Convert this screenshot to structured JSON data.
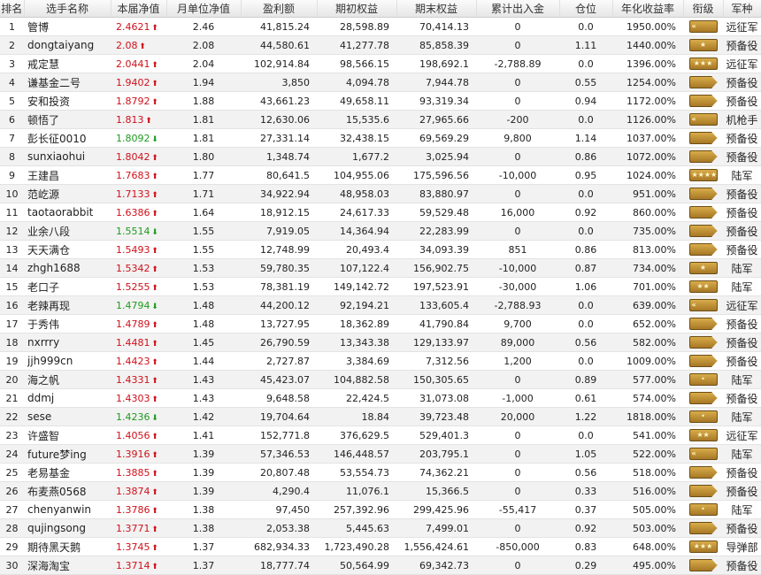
{
  "headers": [
    "排名",
    "选手名称",
    "本届净值",
    "月单位净值",
    "盈利额",
    "期初权益",
    "期末权益",
    "累计出入金",
    "仓位",
    "年化收益率",
    "衔级",
    "军种"
  ],
  "colors": {
    "up": "#d0101a",
    "down": "#1e9a1e"
  },
  "rows": [
    {
      "rank": "1",
      "name": "管博",
      "nav": "2.4621",
      "dir": "up",
      "unit": "2.46",
      "profit": "41,815.24",
      "start": "28,598.89",
      "end": "70,414.13",
      "flow": "0",
      "pos": "0.0",
      "annual": "1950.00%",
      "badge": "chevron",
      "army": "远征军"
    },
    {
      "rank": "2",
      "name": "dongtaiyang",
      "nav": "2.08",
      "dir": "up",
      "unit": "2.08",
      "profit": "44,580.61",
      "start": "41,277.78",
      "end": "85,858.39",
      "flow": "0",
      "pos": "1.11",
      "annual": "1440.00%",
      "badge": "star1",
      "army": "预备役"
    },
    {
      "rank": "3",
      "name": "戒定慧",
      "nav": "2.0441",
      "dir": "up",
      "unit": "2.04",
      "profit": "102,914.84",
      "start": "98,566.15",
      "end": "198,692.1",
      "flow": "-2,788.89",
      "pos": "0.0",
      "annual": "1396.00%",
      "badge": "star3",
      "army": "远征军"
    },
    {
      "rank": "4",
      "name": "谦基金二号",
      "nav": "1.9402",
      "dir": "up",
      "unit": "1.94",
      "profit": "3,850",
      "start": "4,094.78",
      "end": "7,944.78",
      "flow": "0",
      "pos": "0.55",
      "annual": "1254.00%",
      "badge": "pointed",
      "army": "预备役"
    },
    {
      "rank": "5",
      "name": "安和投资",
      "nav": "1.8792",
      "dir": "up",
      "unit": "1.88",
      "profit": "43,661.23",
      "start": "49,658.11",
      "end": "93,319.34",
      "flow": "0",
      "pos": "0.94",
      "annual": "1172.00%",
      "badge": "pointed",
      "army": "预备役"
    },
    {
      "rank": "6",
      "name": "顿悟了",
      "nav": "1.813",
      "dir": "up",
      "unit": "1.81",
      "profit": "12,630.06",
      "start": "15,535.6",
      "end": "27,965.66",
      "flow": "-200",
      "pos": "0.0",
      "annual": "1126.00%",
      "badge": "chevron",
      "army": "机枪手"
    },
    {
      "rank": "7",
      "name": "彭长征0010",
      "nav": "1.8092",
      "dir": "down",
      "unit": "1.81",
      "profit": "27,331.14",
      "start": "32,438.15",
      "end": "69,569.29",
      "flow": "9,800",
      "pos": "1.14",
      "annual": "1037.00%",
      "badge": "pointed",
      "army": "预备役"
    },
    {
      "rank": "8",
      "name": "sunxiaohui",
      "nav": "1.8042",
      "dir": "up",
      "unit": "1.80",
      "profit": "1,348.74",
      "start": "1,677.2",
      "end": "3,025.94",
      "flow": "0",
      "pos": "0.86",
      "annual": "1072.00%",
      "badge": "pointed",
      "army": "预备役"
    },
    {
      "rank": "9",
      "name": "王建昌",
      "nav": "1.7683",
      "dir": "up",
      "unit": "1.77",
      "profit": "80,641.5",
      "start": "104,955.06",
      "end": "175,596.56",
      "flow": "-10,000",
      "pos": "0.95",
      "annual": "1024.00%",
      "badge": "star4",
      "army": "陆军"
    },
    {
      "rank": "10",
      "name": "范屹源",
      "nav": "1.7133",
      "dir": "up",
      "unit": "1.71",
      "profit": "34,922.94",
      "start": "48,958.03",
      "end": "83,880.97",
      "flow": "0",
      "pos": "0.0",
      "annual": "951.00%",
      "badge": "pointed",
      "army": "预备役"
    },
    {
      "rank": "11",
      "name": "taotaorabbit",
      "nav": "1.6386",
      "dir": "up",
      "unit": "1.64",
      "profit": "18,912.15",
      "start": "24,617.33",
      "end": "59,529.48",
      "flow": "16,000",
      "pos": "0.92",
      "annual": "860.00%",
      "badge": "pointed",
      "army": "预备役"
    },
    {
      "rank": "12",
      "name": "业余八段",
      "nav": "1.5514",
      "dir": "down",
      "unit": "1.55",
      "profit": "7,919.05",
      "start": "14,364.94",
      "end": "22,283.99",
      "flow": "0",
      "pos": "0.0",
      "annual": "735.00%",
      "badge": "pointed",
      "army": "预备役"
    },
    {
      "rank": "13",
      "name": "天天满仓",
      "nav": "1.5493",
      "dir": "up",
      "unit": "1.55",
      "profit": "12,748.99",
      "start": "20,493.4",
      "end": "34,093.39",
      "flow": "851",
      "pos": "0.86",
      "annual": "813.00%",
      "badge": "pointed",
      "army": "预备役"
    },
    {
      "rank": "14",
      "name": "zhgh1688",
      "nav": "1.5342",
      "dir": "up",
      "unit": "1.53",
      "profit": "59,780.35",
      "start": "107,122.4",
      "end": "156,902.75",
      "flow": "-10,000",
      "pos": "0.87",
      "annual": "734.00%",
      "badge": "star1",
      "army": "陆军"
    },
    {
      "rank": "15",
      "name": "老口子",
      "nav": "1.5255",
      "dir": "up",
      "unit": "1.53",
      "profit": "78,381.19",
      "start": "149,142.72",
      "end": "197,523.91",
      "flow": "-30,000",
      "pos": "1.06",
      "annual": "701.00%",
      "badge": "star2",
      "army": "陆军"
    },
    {
      "rank": "16",
      "name": "老辣再现",
      "nav": "1.4794",
      "dir": "down",
      "unit": "1.48",
      "profit": "44,200.12",
      "start": "92,194.21",
      "end": "133,605.4",
      "flow": "-2,788.93",
      "pos": "0.0",
      "annual": "639.00%",
      "badge": "chevron",
      "army": "远征军"
    },
    {
      "rank": "17",
      "name": "于秀伟",
      "nav": "1.4789",
      "dir": "up",
      "unit": "1.48",
      "profit": "13,727.95",
      "start": "18,362.89",
      "end": "41,790.84",
      "flow": "9,700",
      "pos": "0.0",
      "annual": "652.00%",
      "badge": "pointed",
      "army": "预备役"
    },
    {
      "rank": "18",
      "name": "nxrrry",
      "nav": "1.4481",
      "dir": "up",
      "unit": "1.45",
      "profit": "26,790.59",
      "start": "13,343.38",
      "end": "129,133.97",
      "flow": "89,000",
      "pos": "0.56",
      "annual": "582.00%",
      "badge": "pointed",
      "army": "预备役"
    },
    {
      "rank": "19",
      "name": "jjh999cn",
      "nav": "1.4423",
      "dir": "up",
      "unit": "1.44",
      "profit": "2,727.87",
      "start": "3,384.69",
      "end": "7,312.56",
      "flow": "1,200",
      "pos": "0.0",
      "annual": "1009.00%",
      "badge": "pointed",
      "army": "预备役"
    },
    {
      "rank": "20",
      "name": "海之帆",
      "nav": "1.4331",
      "dir": "up",
      "unit": "1.43",
      "profit": "45,423.07",
      "start": "104,882.58",
      "end": "150,305.65",
      "flow": "0",
      "pos": "0.89",
      "annual": "577.00%",
      "badge": "star0",
      "army": "陆军"
    },
    {
      "rank": "21",
      "name": "ddmj",
      "nav": "1.4303",
      "dir": "up",
      "unit": "1.43",
      "profit": "9,648.58",
      "start": "22,424.5",
      "end": "31,073.08",
      "flow": "-1,000",
      "pos": "0.61",
      "annual": "574.00%",
      "badge": "pointed",
      "army": "预备役"
    },
    {
      "rank": "22",
      "name": "sese",
      "nav": "1.4236",
      "dir": "down",
      "unit": "1.42",
      "profit": "19,704.64",
      "start": "18.84",
      "end": "39,723.48",
      "flow": "20,000",
      "pos": "1.22",
      "annual": "1818.00%",
      "badge": "star0",
      "army": "陆军"
    },
    {
      "rank": "23",
      "name": "许盛智",
      "nav": "1.4056",
      "dir": "up",
      "unit": "1.41",
      "profit": "152,771.8",
      "start": "376,629.5",
      "end": "529,401.3",
      "flow": "0",
      "pos": "0.0",
      "annual": "541.00%",
      "badge": "star2",
      "army": "远征军"
    },
    {
      "rank": "24",
      "name": "future梦ing",
      "nav": "1.3916",
      "dir": "up",
      "unit": "1.39",
      "profit": "57,346.53",
      "start": "146,448.57",
      "end": "203,795.1",
      "flow": "0",
      "pos": "1.05",
      "annual": "522.00%",
      "badge": "chevron",
      "army": "陆军"
    },
    {
      "rank": "25",
      "name": "老易基金",
      "nav": "1.3885",
      "dir": "up",
      "unit": "1.39",
      "profit": "20,807.48",
      "start": "53,554.73",
      "end": "74,362.21",
      "flow": "0",
      "pos": "0.56",
      "annual": "518.00%",
      "badge": "pointed",
      "army": "预备役"
    },
    {
      "rank": "26",
      "name": "布麦燕0568",
      "nav": "1.3874",
      "dir": "up",
      "unit": "1.39",
      "profit": "4,290.4",
      "start": "11,076.1",
      "end": "15,366.5",
      "flow": "0",
      "pos": "0.33",
      "annual": "516.00%",
      "badge": "pointed",
      "army": "预备役"
    },
    {
      "rank": "27",
      "name": "chenyanwin",
      "nav": "1.3786",
      "dir": "up",
      "unit": "1.38",
      "profit": "97,450",
      "start": "257,392.96",
      "end": "299,425.96",
      "flow": "-55,417",
      "pos": "0.37",
      "annual": "505.00%",
      "badge": "star0",
      "army": "陆军"
    },
    {
      "rank": "28",
      "name": "qujingsong",
      "nav": "1.3771",
      "dir": "up",
      "unit": "1.38",
      "profit": "2,053.38",
      "start": "5,445.63",
      "end": "7,499.01",
      "flow": "0",
      "pos": "0.92",
      "annual": "503.00%",
      "badge": "pointed",
      "army": "预备役"
    },
    {
      "rank": "29",
      "name": "期待黑天鹅",
      "nav": "1.3745",
      "dir": "up",
      "unit": "1.37",
      "profit": "682,934.33",
      "start": "1,723,490.28",
      "end": "1,556,424.61",
      "flow": "-850,000",
      "pos": "0.83",
      "annual": "648.00%",
      "badge": "star3",
      "army": "导弹部"
    },
    {
      "rank": "30",
      "name": "深海淘宝",
      "nav": "1.3714",
      "dir": "up",
      "unit": "1.37",
      "profit": "18,777.74",
      "start": "50,564.99",
      "end": "69,342.73",
      "flow": "0",
      "pos": "0.29",
      "annual": "495.00%",
      "badge": "pointed",
      "army": "预备役"
    }
  ]
}
